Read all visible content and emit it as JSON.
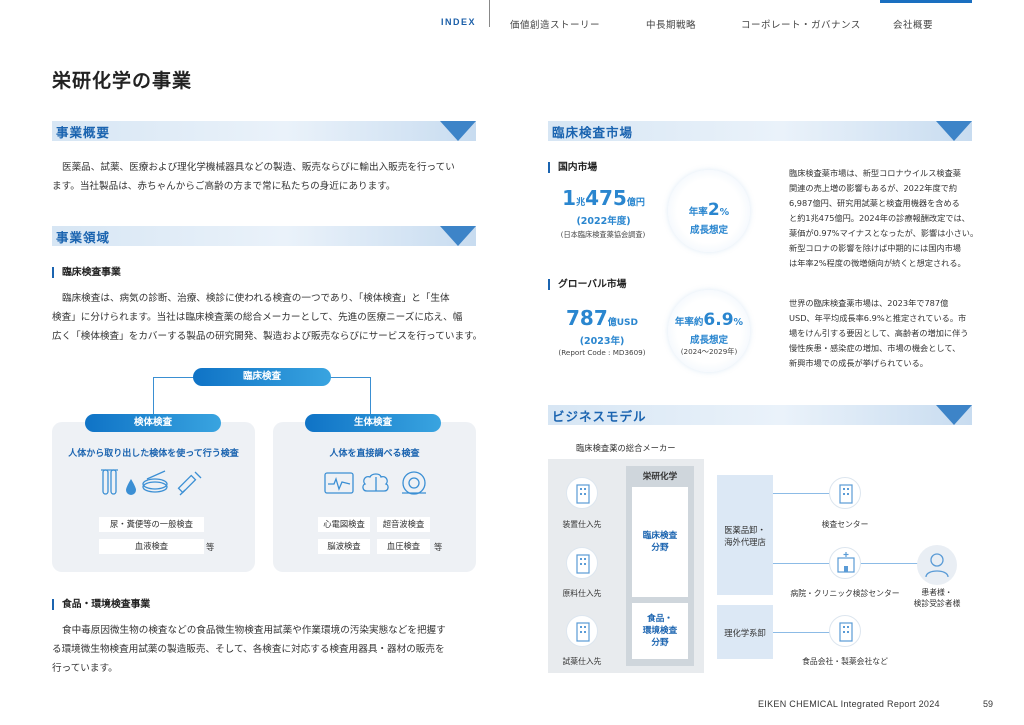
{
  "nav": {
    "index": "INDEX",
    "items": [
      "価値創造ストーリー",
      "中長期戦略",
      "コーポレート・ガバナンス",
      "会社概要"
    ]
  },
  "page_title": "栄研化学の事業",
  "overview": {
    "heading": "事業概要",
    "text_line1": "医薬品、試薬、医療および理化学機械器具などの製造、販売ならびに輸出入販売を行ってい",
    "text_line2": "ます。当社製品は、赤ちゃんからご高齢の方まで常に私たちの身近にあります。"
  },
  "domain": {
    "heading": "事業領域",
    "clinical": {
      "subheading": "臨床検査事業",
      "line1": "臨床検査は、病気の診断、治療、検診に使われる検査の一つであり、「検体検査」と「生体",
      "line2": "検査」に分けられます。当社は臨床検査薬の総合メーカーとして、先進の医療ニーズに応え、幅",
      "line3": "広く「検体検査」をカバーする製品の研究開発、製造および販売ならびにサービスを行っています。",
      "root": "臨床検査",
      "left": {
        "label": "検体検査",
        "title": "人体から取り出した検体を使って行う検査",
        "tag1": "尿・糞便等の一般検査",
        "tag2": "血液検査",
        "etc": "等",
        "icons": [
          "test-tubes-icon",
          "droplet-icon",
          "petri-dish-icon",
          "syringe-icon"
        ]
      },
      "right": {
        "label": "生体検査",
        "title": "人体を直接調べる検査",
        "tag1": "心電図検査",
        "tag2": "超音波検査",
        "tag3": "脳波検査",
        "tag4": "血圧検査",
        "etc": "等",
        "icons": [
          "ecg-monitor-icon",
          "brain-icon",
          "ct-scanner-icon"
        ]
      }
    },
    "food": {
      "subheading": "食品・環境検査事業",
      "line1": "食中毒原因微生物の検査などの食品微生物検査用試薬や作業環境の汚染実態などを把握す",
      "line2": "る環境微生物検査用試薬の製造販売、そして、各検査に対応する検査用器具・器材の販売を",
      "line3": "行っています。"
    }
  },
  "market": {
    "heading": "臨床検査市場",
    "domestic": {
      "subheading": "国内市場",
      "num_cho": "1",
      "unit_cho": "兆",
      "num_oku": "475",
      "unit_oku": "億円",
      "year": "(2022年度)",
      "source": "(日本臨床検査薬協会調査)",
      "growth_prefix": "年率",
      "growth_num": "2",
      "growth_unit": "%",
      "growth_label": "成長想定",
      "desc": [
        "臨床検査薬市場は、新型コロナウイルス検査薬",
        "関連の売上増の影響もあるが、2022年度で約",
        "6,987億円、研究用試薬と検査用機器を含める",
        "と約1兆475億円。2024年の診療報酬改定では、",
        "薬価が0.97%マイナスとなったが、影響は小さい。",
        "新型コロナの影響を除けば中期的には国内市場",
        "は年率2%程度の微増傾向が続くと想定される。"
      ]
    },
    "global": {
      "subheading": "グローバル市場",
      "num": "787",
      "unit": "億USD",
      "year": "(2023年)",
      "source": "(Report Code : MD3609)",
      "growth_prefix": "年率約",
      "growth_num": "6.9",
      "growth_unit": "%",
      "growth_label": "成長想定",
      "growth_years": "(2024～2029年)",
      "desc": [
        "世界の臨床検査薬市場は、2023年で787億",
        "USD、年平均成長率6.9%と推定されている。市",
        "場をけん引する要因として、高齢者の増加に伴う",
        "慢性疾患・感染症の増加、市場の機会として、",
        "新興市場での成長が挙げられている。"
      ]
    }
  },
  "business_model": {
    "heading": "ビジネスモデル",
    "caption": "臨床検査薬の総合メーカー",
    "company": "栄研化学",
    "clinical_field": [
      "臨床検査",
      "分野"
    ],
    "food_field": [
      "食品・",
      "環境検査",
      "分野"
    ],
    "suppliers": [
      "装置仕入先",
      "原料仕入先",
      "試薬仕入先"
    ],
    "wholesale": [
      "医薬品卸・",
      "海外代理店"
    ],
    "chem": "理化学系卸",
    "customers": [
      "検査センター",
      "病院・クリニック検診センター",
      "食品会社・製薬会社など"
    ],
    "patient": [
      "患者様・",
      "検診受診者様"
    ]
  },
  "footer": "EIKEN CHEMICAL  Integrated Report 2024",
  "page_number": "59"
}
